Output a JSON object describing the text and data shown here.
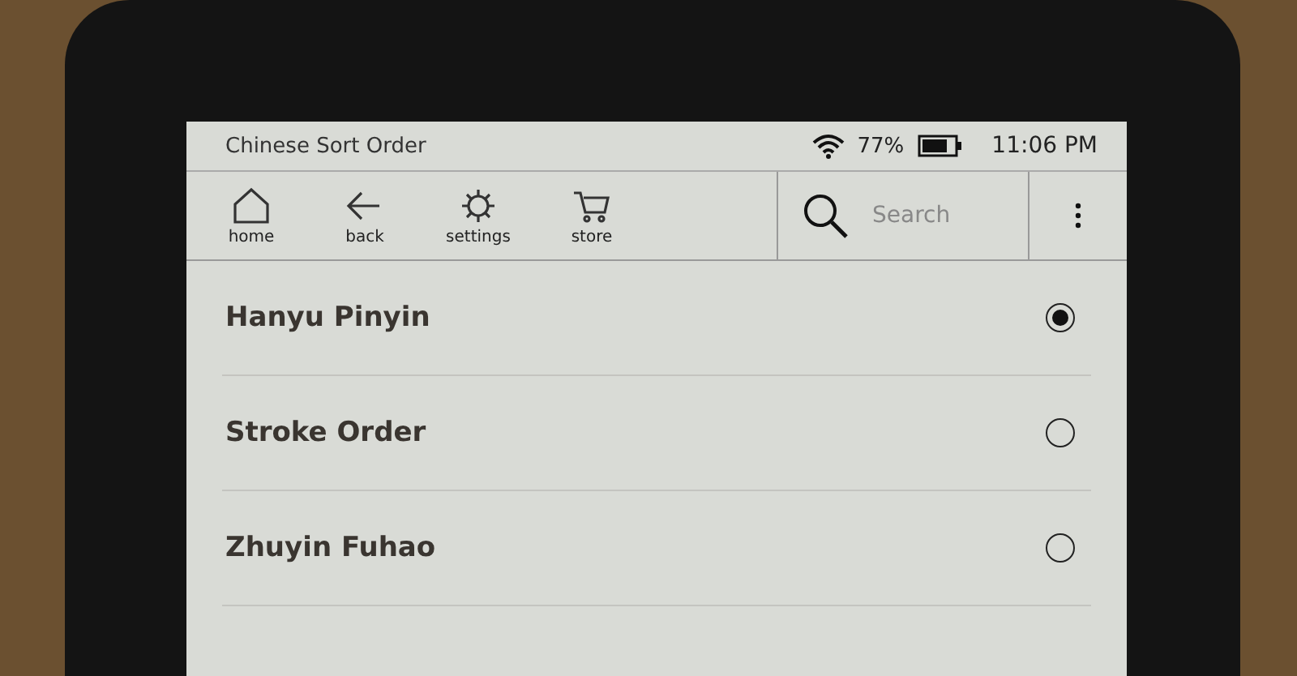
{
  "status_bar": {
    "title": "Chinese Sort Order",
    "battery": "77%",
    "time": "11:06 PM"
  },
  "toolbar": {
    "items": [
      {
        "kind": "home",
        "label": "home"
      },
      {
        "kind": "back",
        "label": "back"
      },
      {
        "kind": "settings",
        "label": "settings"
      },
      {
        "kind": "store",
        "label": "store"
      }
    ],
    "search": {
      "placeholder": "Search"
    }
  },
  "options": [
    {
      "label": "Hanyu Pinyin",
      "selected": true
    },
    {
      "label": "Stroke Order",
      "selected": false
    },
    {
      "label": "Zhuyin Fuhao",
      "selected": false
    }
  ]
}
